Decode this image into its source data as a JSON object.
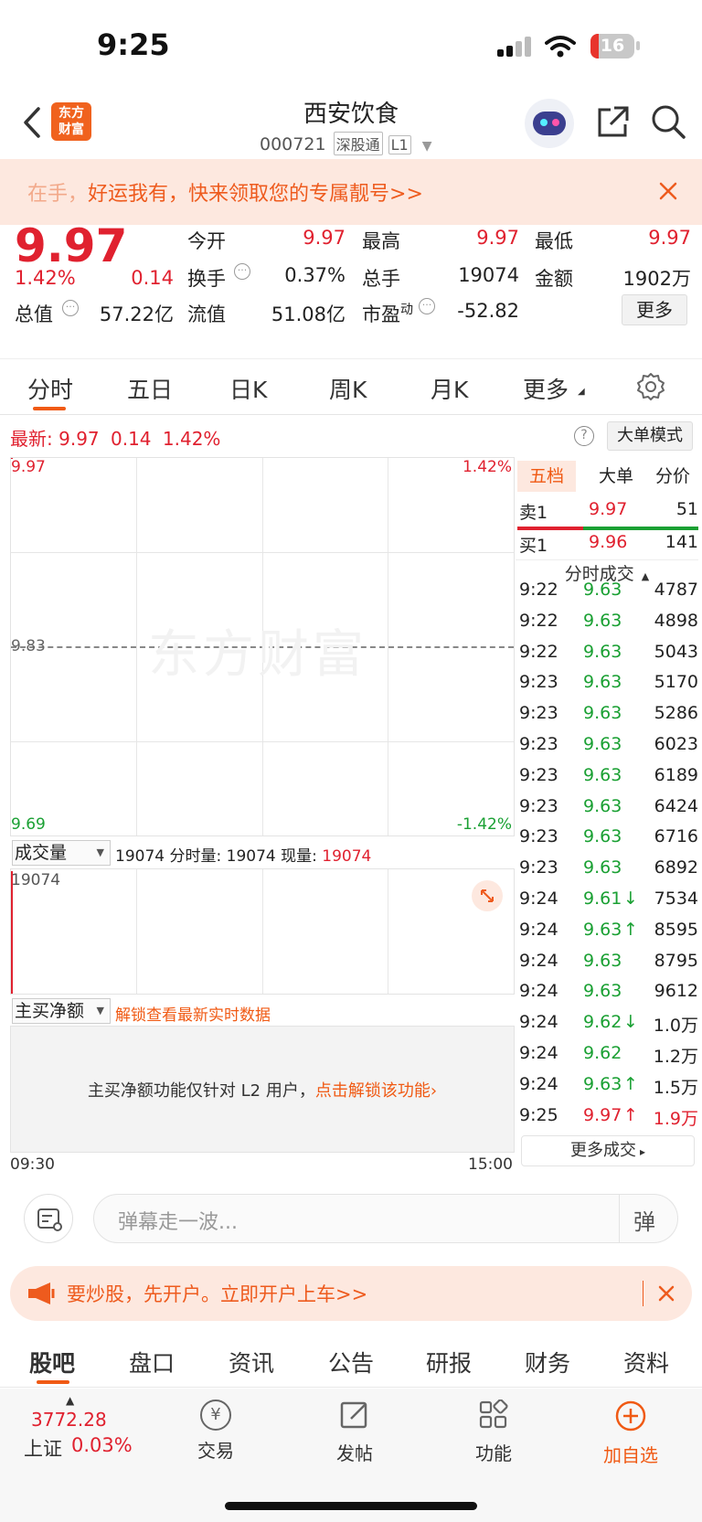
{
  "status_bar": {
    "time": "9:25",
    "battery": "16"
  },
  "header": {
    "logo_line1": "东方",
    "logo_line2": "财富",
    "stock_name": "西安饮食",
    "stock_code": "000721",
    "market_tag": "深股通",
    "level_tag": "L1"
  },
  "banner": {
    "text_prefix": "在手，",
    "text_main": "好运我有，快来领取您的专属靓号>>"
  },
  "quote": {
    "price": "9.97",
    "change_pct": "1.42%",
    "change": "0.14",
    "open_label": "今开",
    "open": "9.97",
    "high_label": "最高",
    "high": "9.97",
    "low_label": "最低",
    "low": "9.97",
    "turnover_label": "换手",
    "turnover": "0.37%",
    "volume_label": "总手",
    "volume": "19074",
    "amount_label": "金额",
    "amount": "1902万",
    "mktcap_label": "总值",
    "mktcap": "57.22亿",
    "float_label": "流值",
    "float": "51.08亿",
    "pe_label": "市盈",
    "pe_sup": "动",
    "pe": "-52.82",
    "more_button": "更多"
  },
  "chart_tabs": [
    "分时",
    "五日",
    "日K",
    "周K",
    "月K",
    "更多"
  ],
  "latest": {
    "label": "最新:",
    "price": "9.97",
    "change": "0.14",
    "pct": "1.42%",
    "mode_button": "大单模式"
  },
  "chart": {
    "y_top": "9.97",
    "y_mid": "9.83",
    "y_bottom": "9.69",
    "pct_top": "1.42%",
    "pct_bottom": "-1.42%",
    "watermark": "东方财富",
    "time_start": "09:30",
    "time_end": "15:00"
  },
  "chart_data": {
    "type": "line",
    "title": "",
    "ylim": [
      9.69,
      9.97
    ],
    "reference_price": 9.83,
    "x": [
      "09:30"
    ],
    "series": [
      {
        "values": [
          9.97
        ]
      }
    ],
    "volume": [
      19074
    ]
  },
  "volume_panel": {
    "selector": "成交量",
    "total": "19074",
    "period_label": "分时量:",
    "period_value": "19074",
    "now_label": "现量:",
    "now_value": "19074",
    "axis_max": "19074"
  },
  "net_panel": {
    "selector": "主买净额",
    "unlock_link": "解锁查看最新实时数据",
    "message": "主买净额功能仅针对 L2 用户，",
    "message_link": "点击解锁该功能"
  },
  "side_tabs": [
    "五档",
    "大单",
    "分价"
  ],
  "order_book": {
    "sell": {
      "label": "卖1",
      "price": "9.97",
      "qty": "51"
    },
    "buy": {
      "label": "买1",
      "price": "9.96",
      "qty": "141"
    }
  },
  "ticks_title": "分时成交",
  "ticks": [
    {
      "time": "9:22",
      "price": "9.63",
      "arrow": "",
      "vol": "4787",
      "color": "green"
    },
    {
      "time": "9:22",
      "price": "9.63",
      "arrow": "",
      "vol": "4898",
      "color": "green"
    },
    {
      "time": "9:22",
      "price": "9.63",
      "arrow": "",
      "vol": "5043",
      "color": "green"
    },
    {
      "time": "9:23",
      "price": "9.63",
      "arrow": "",
      "vol": "5170",
      "color": "green"
    },
    {
      "time": "9:23",
      "price": "9.63",
      "arrow": "",
      "vol": "5286",
      "color": "green"
    },
    {
      "time": "9:23",
      "price": "9.63",
      "arrow": "",
      "vol": "6023",
      "color": "green"
    },
    {
      "time": "9:23",
      "price": "9.63",
      "arrow": "",
      "vol": "6189",
      "color": "green"
    },
    {
      "time": "9:23",
      "price": "9.63",
      "arrow": "",
      "vol": "6424",
      "color": "green"
    },
    {
      "time": "9:23",
      "price": "9.63",
      "arrow": "",
      "vol": "6716",
      "color": "green"
    },
    {
      "time": "9:23",
      "price": "9.63",
      "arrow": "",
      "vol": "6892",
      "color": "green"
    },
    {
      "time": "9:24",
      "price": "9.61",
      "arrow": "↓",
      "vol": "7534",
      "color": "green"
    },
    {
      "time": "9:24",
      "price": "9.63",
      "arrow": "↑",
      "vol": "8595",
      "color": "green"
    },
    {
      "time": "9:24",
      "price": "9.63",
      "arrow": "",
      "vol": "8795",
      "color": "green"
    },
    {
      "time": "9:24",
      "price": "9.63",
      "arrow": "",
      "vol": "9612",
      "color": "green"
    },
    {
      "time": "9:24",
      "price": "9.62",
      "arrow": "↓",
      "vol": "1.0万",
      "color": "green"
    },
    {
      "time": "9:24",
      "price": "9.62",
      "arrow": "",
      "vol": "1.2万",
      "color": "green"
    },
    {
      "time": "9:24",
      "price": "9.63",
      "arrow": "↑",
      "vol": "1.5万",
      "color": "green"
    },
    {
      "time": "9:25",
      "price": "9.97",
      "arrow": "↑",
      "vol": "1.9万",
      "color": "red"
    }
  ],
  "more_ticks": "更多成交",
  "chat": {
    "placeholder": "弹幕走一波...",
    "danmu_button": "弹"
  },
  "promo": {
    "text": "要炒股，先开户。立即开户上车>>"
  },
  "footer_tabs": [
    "股吧",
    "盘口",
    "资讯",
    "公告",
    "研报",
    "财务",
    "资料"
  ],
  "bottom_nav": {
    "index_value": "3772.28",
    "index_name": "上证",
    "index_pct": "0.03%",
    "trade": "交易",
    "post": "发帖",
    "function": "功能",
    "add_watch": "加自选",
    "trade_glyph": "¥"
  },
  "colors": {
    "up": "#e0212f",
    "down": "#1aa033",
    "accent": "#f05a14",
    "banner_bg": "#fde8df"
  }
}
